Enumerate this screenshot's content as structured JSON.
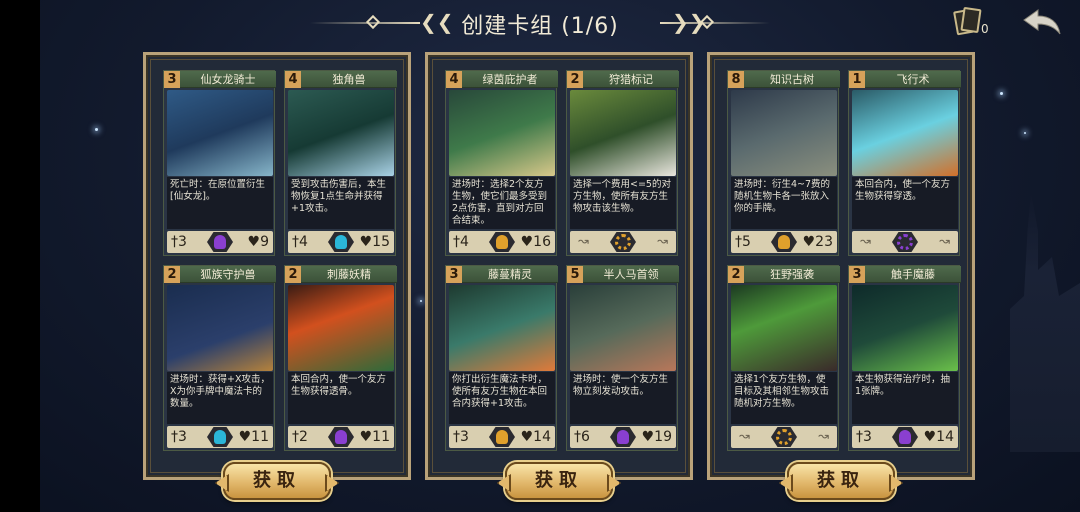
{
  "header": {
    "title": "创建卡组 (1/6)",
    "deck_count": "0"
  },
  "colors": {
    "panel_border": "#b9a27a",
    "card_header": "#4f6a4c",
    "cost_badge": "#d6a25a",
    "stat_bar": "#d9cfb0",
    "button_gold": "#e2b86c",
    "faction_purple": "#8a3fd0",
    "faction_cyan": "#2bb6d8",
    "faction_orange": "#e0a02c"
  },
  "panels": [
    {
      "button_label": "获取",
      "cards": [
        {
          "cost": "3",
          "name": "仙女龙骑士",
          "desc": "死亡时：在原位置衍生[仙女龙]。",
          "atk": "3",
          "hp": "9",
          "faction": "purple",
          "type": "creature"
        },
        {
          "cost": "4",
          "name": "独角兽",
          "desc": "受到攻击伤害后，本生物恢复1点生命并获得+1攻击。",
          "atk": "4",
          "hp": "15",
          "faction": "cyan",
          "type": "creature"
        },
        {
          "cost": "2",
          "name": "狐族守护兽",
          "desc": "进场时：获得+X攻击，X为你手牌中魔法卡的数量。",
          "atk": "3",
          "hp": "11",
          "faction": "cyan",
          "type": "creature"
        },
        {
          "cost": "2",
          "name": "刺藤妖精",
          "desc": "本回合内，使一个友方生物获得透骨。",
          "atk": "2",
          "hp": "11",
          "faction": "purple",
          "type": "creature"
        }
      ]
    },
    {
      "button_label": "获取",
      "cards": [
        {
          "cost": "4",
          "name": "绿茵庇护者",
          "desc": "进场时：选择2个友方生物，使它们最多受到2点伤害，直到对方回合结束。",
          "atk": "4",
          "hp": "16",
          "faction": "orange",
          "type": "creature"
        },
        {
          "cost": "2",
          "name": "狩猎标记",
          "desc": "选择一个费用<=5的对方生物，使所有友方生物攻击该生物。",
          "atk": "",
          "hp": "",
          "faction": "orange",
          "type": "spell"
        },
        {
          "cost": "3",
          "name": "藤蔓精灵",
          "desc": "你打出衍生魔法卡时，使所有友方生物在本回合内获得+1攻击。",
          "atk": "3",
          "hp": "14",
          "faction": "orange",
          "type": "creature"
        },
        {
          "cost": "5",
          "name": "半人马首领",
          "desc": "进场时：使一个友方生物立刻发动攻击。",
          "atk": "6",
          "hp": "19",
          "faction": "purple",
          "type": "creature"
        }
      ]
    },
    {
      "button_label": "获取",
      "cards": [
        {
          "cost": "8",
          "name": "知识古树",
          "desc": "进场时：衍生4~7费的随机生物卡各一张放入你的手牌。",
          "atk": "5",
          "hp": "23",
          "faction": "orange",
          "type": "creature"
        },
        {
          "cost": "1",
          "name": "飞行术",
          "desc": "本回合内，使一个友方生物获得穿透。",
          "atk": "",
          "hp": "",
          "faction": "purple",
          "type": "spell"
        },
        {
          "cost": "2",
          "name": "狂野强袭",
          "desc": "选择1个友方生物，使目标及其相邻生物攻击随机对方生物。",
          "atk": "",
          "hp": "",
          "faction": "orange",
          "type": "spell"
        },
        {
          "cost": "3",
          "name": "触手魔藤",
          "desc": "本生物获得治疗时，抽1张牌。",
          "atk": "3",
          "hp": "14",
          "faction": "purple",
          "type": "creature"
        }
      ]
    }
  ]
}
